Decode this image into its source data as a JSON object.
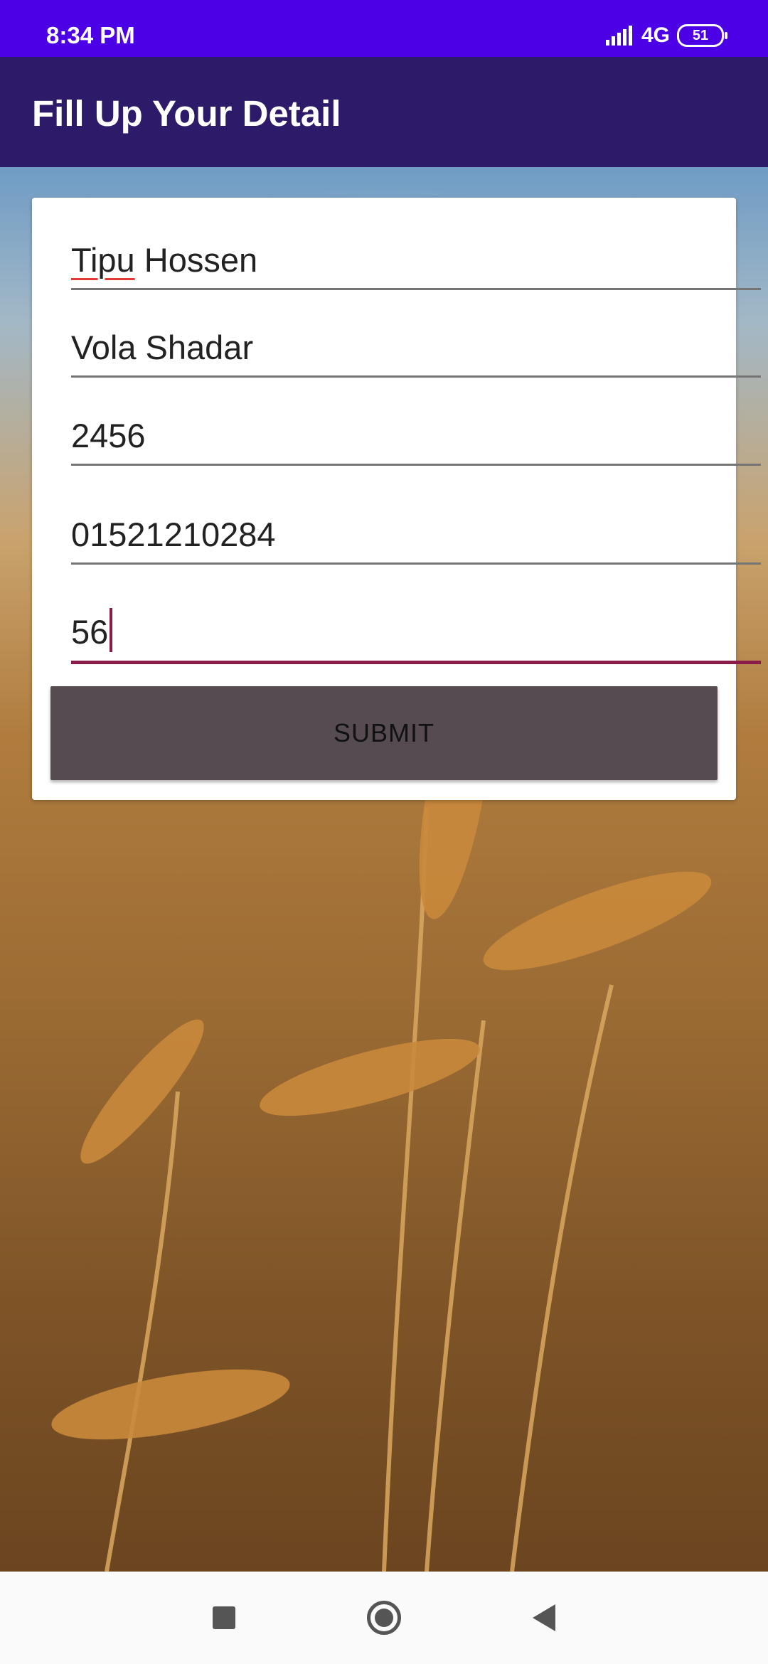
{
  "status_bar": {
    "time": "8:34 PM",
    "network": "4G",
    "battery": "51"
  },
  "app_bar": {
    "title": "Fill Up Your Detail"
  },
  "form": {
    "fields": [
      {
        "value_part1": "Tipu",
        "value_part2": " Hossen"
      },
      {
        "value": "Vola Shadar"
      },
      {
        "value": "2456"
      },
      {
        "value": "01521210284"
      },
      {
        "value": "56"
      }
    ],
    "submit_label": "SUBMIT"
  },
  "colors": {
    "status_bar": "#4c00e6",
    "app_bar": "#2d1b69",
    "accent": "#8a1c4a",
    "button": "#574b52"
  },
  "icons": {
    "nav": [
      "recents-icon",
      "home-icon",
      "back-icon"
    ]
  }
}
